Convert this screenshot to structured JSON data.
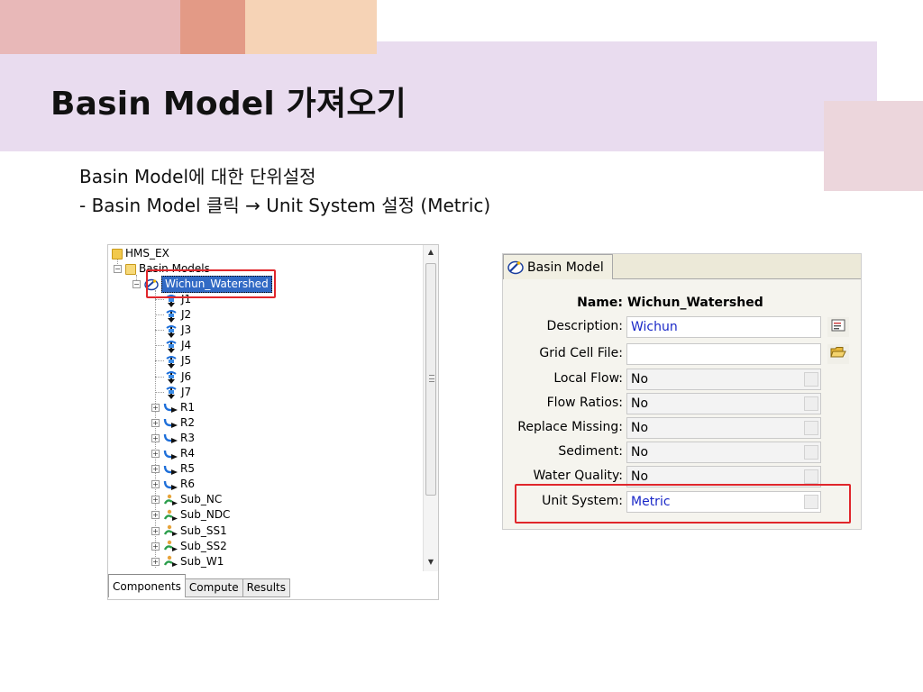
{
  "slide": {
    "title": "Basin Model 가져오기",
    "line1": "Basin Model에 대한 단위설정",
    "line2": "- Basin Model 클릭 → Unit System 설정 (Metric)"
  },
  "tree": {
    "root": "HMS_EX",
    "folder": "Basin Models",
    "selected": "Wichun_Watershed",
    "junctions": [
      "J1",
      "J2",
      "J3",
      "J4",
      "J5",
      "J6",
      "J7"
    ],
    "reaches": [
      "R1",
      "R2",
      "R3",
      "R4",
      "R5",
      "R6"
    ],
    "subbasins": [
      "Sub_NC",
      "Sub_NDC",
      "Sub_SS1",
      "Sub_SS2",
      "Sub_W1"
    ],
    "tabs": [
      "Components",
      "Compute",
      "Results"
    ],
    "active_tab": "Components"
  },
  "props": {
    "tab_label": "Basin Model",
    "name_label": "Name:",
    "name_value": "Wichun_Watershed",
    "description_label": "Description:",
    "description_value": "Wichun",
    "grid_cell_label": "Grid Cell File:",
    "grid_cell_value": "",
    "local_flow_label": "Local Flow:",
    "local_flow_value": "No",
    "flow_ratios_label": "Flow Ratios:",
    "flow_ratios_value": "No",
    "replace_missing_label": "Replace Missing:",
    "replace_missing_value": "No",
    "sediment_label": "Sediment:",
    "sediment_value": "No",
    "water_quality_label": "Water Quality:",
    "water_quality_value": "No",
    "unit_system_label": "Unit System:",
    "unit_system_value": "Metric"
  },
  "colors": {
    "highlight_red": "#e0262b",
    "value_blue": "#1a28c8",
    "selection_blue": "#316ac5",
    "title_band": "#e9dcef"
  }
}
